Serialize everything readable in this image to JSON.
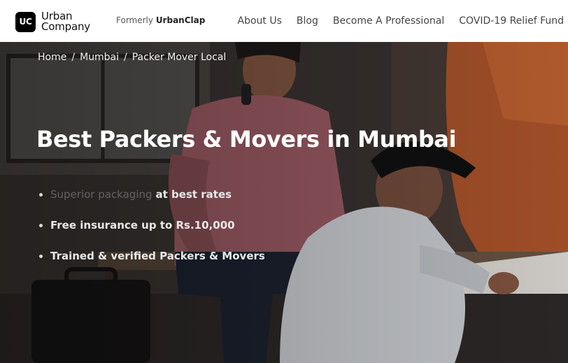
{
  "header": {
    "logo_mark": "UC",
    "logo_line1": "Urban",
    "logo_line2": "Company",
    "formerly_prefix": "Formerly",
    "formerly_brand": "UrbanClap",
    "nav": [
      "About Us",
      "Blog",
      "Become A Professional",
      "COVID-19 Relief Fund"
    ]
  },
  "breadcrumb": {
    "items": [
      "Home",
      "Mumbai",
      "Packer Mover Local"
    ],
    "separator": "/"
  },
  "hero": {
    "title": "Best Packers & Movers in Mumbai",
    "features": [
      {
        "faded": "Superior packaging",
        "text": "at best rates"
      },
      {
        "faded": "",
        "text": "Free insurance up to Rs.10,000"
      },
      {
        "faded": "",
        "text": "Trained & verified Packers & Movers"
      }
    ]
  },
  "colors": {
    "header_bg": "#ffffff",
    "logo_bg": "#000000",
    "hero_text": "#ffffff"
  },
  "icons": [
    "uc-logo-icon",
    "bullet-dot-icon"
  ]
}
